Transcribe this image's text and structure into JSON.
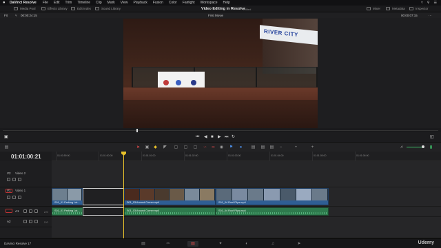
{
  "menubar": {
    "app": "DaVinci Resolve",
    "items": [
      "File",
      "Edit",
      "Trim",
      "Timeline",
      "Clip",
      "Mark",
      "View",
      "Playback",
      "Fusion",
      "Color",
      "Fairlight",
      "Workspace",
      "Help"
    ]
  },
  "toolbar": {
    "media_pool": "Media Pool",
    "effects_library": "Effects Library",
    "edit_index": "Edit Index",
    "sound_library": "Sound Library",
    "project_title": "Video Editing in Resolve",
    "project_state": "Edited",
    "mixer": "Mixer",
    "metadata": "Metadata",
    "inspector": "Inspector"
  },
  "viewer": {
    "zoom": "Fit",
    "source_timecode": "00:00:24:15",
    "timeline_name": "First Movie",
    "duration_timecode": "00:00:07:15",
    "sign_text": "RIVER CITY"
  },
  "timeline": {
    "current_timecode": "01:01:00:21",
    "ruler_ticks": [
      "01:00:59:00",
      "01:01:00:00",
      "01:01:01:00",
      "01:01:02:00",
      "01:01:03:00",
      "01:01:04:00",
      "01:01:05:00",
      "01:01:06:00"
    ],
    "tracks": {
      "v2": {
        "id": "V2",
        "name": "Video 2"
      },
      "v1": {
        "id": "V1",
        "name": "Video 1"
      },
      "a1": {
        "id": "A1",
        "num": "2.0"
      },
      "a2": {
        "id": "A2",
        "num": "2.0"
      }
    },
    "video_clips": [
      "S01_01 Parking Lot...",
      "S01_03 Around Corner.mp4",
      "S01_04 Roof Flips.mp4"
    ],
    "audio_clips": [
      "S01_01 Parking Lot...",
      "S01_03 Around Corner.mp4",
      "S01_04 Roof Flips.mp4"
    ]
  },
  "pagebar": {
    "brand": "DaVinci Resolve 17",
    "watermark": "Udemy"
  },
  "colors": {
    "playhead": "#e8c12a",
    "video_clip": "#2f5e94",
    "audio_clip": "#2e7a4d",
    "active_page": "#e04a4a"
  }
}
